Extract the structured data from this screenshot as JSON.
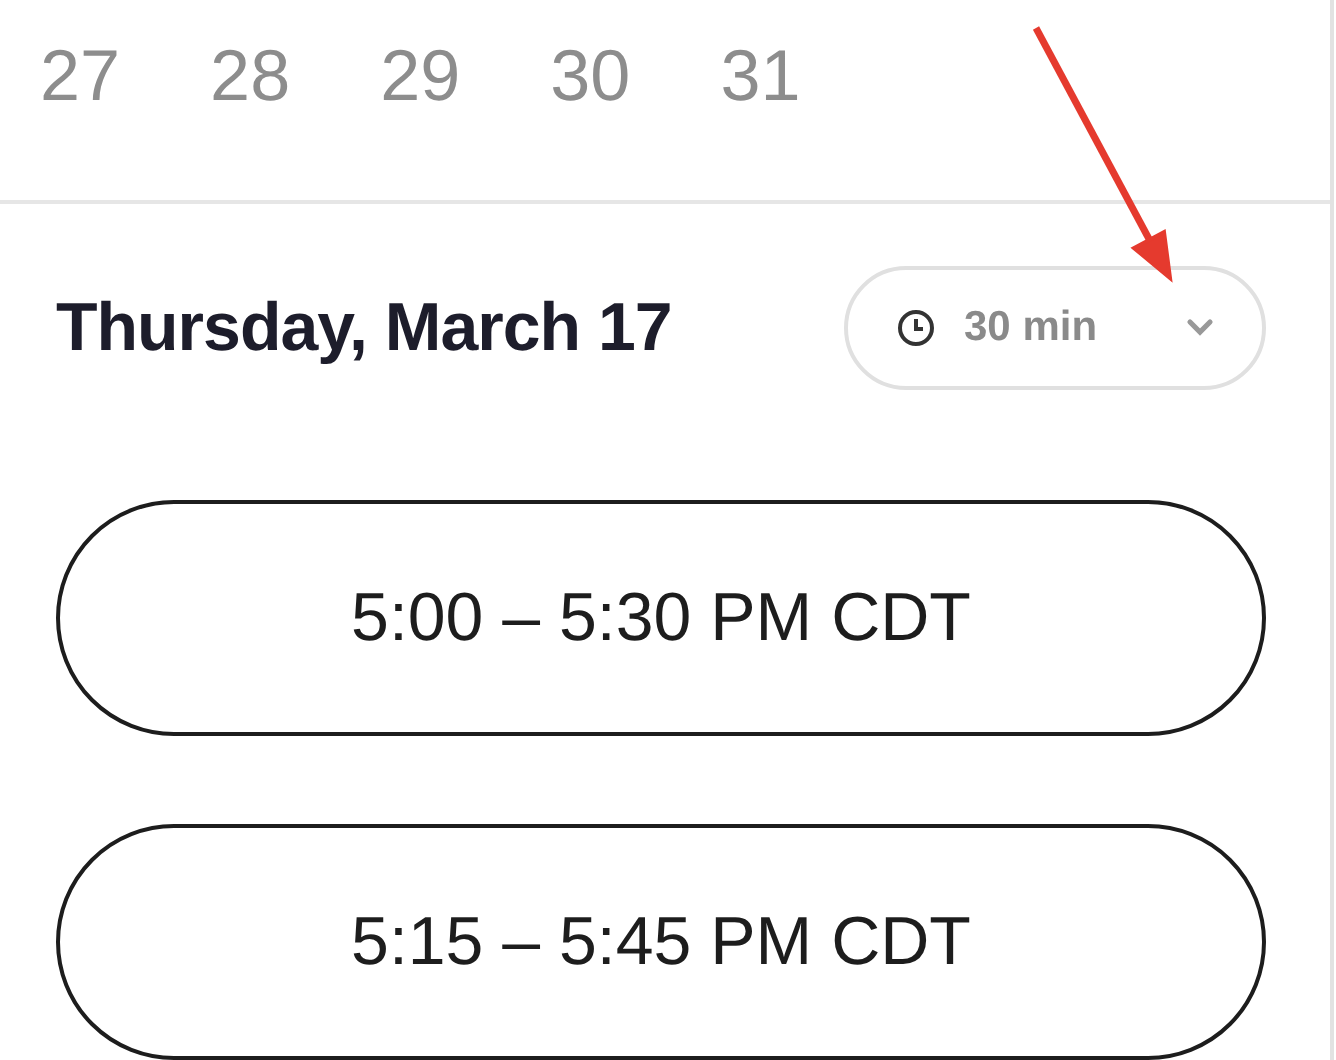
{
  "dates": [
    {
      "label": "27"
    },
    {
      "label": "28"
    },
    {
      "label": "29"
    },
    {
      "label": "30"
    },
    {
      "label": "31"
    }
  ],
  "day_heading": "Thursday, March 17",
  "duration_dropdown": {
    "value": "30 min"
  },
  "time_slots": [
    {
      "label": "5:00 – 5:30 PM CDT"
    },
    {
      "label": "5:15 – 5:45 PM CDT"
    }
  ],
  "annotation": {
    "kind": "arrow"
  }
}
